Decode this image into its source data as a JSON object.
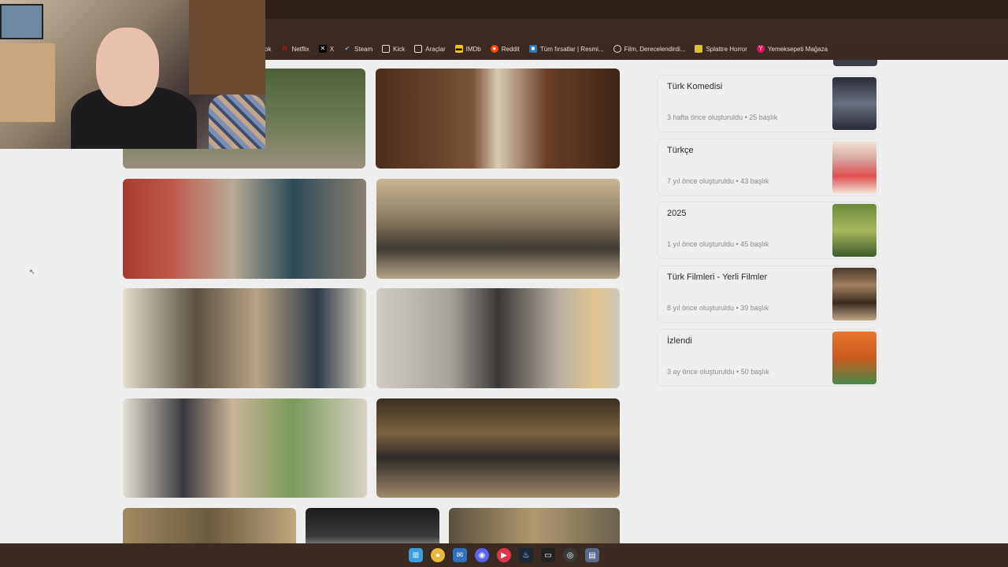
{
  "bookmarks": [
    {
      "label": "ok",
      "icon": "bookmark-icon"
    },
    {
      "label": "Netflix",
      "icon": "netflix-icon",
      "color": "#e50914"
    },
    {
      "label": "X",
      "icon": "x-icon",
      "color": "#000000"
    },
    {
      "label": "Steam",
      "icon": "steam-icon",
      "color": "#1b6fb7"
    },
    {
      "label": "Kick",
      "icon": "folder-icon"
    },
    {
      "label": "Araçlar",
      "icon": "folder-icon"
    },
    {
      "label": "IMDb",
      "icon": "imdb-icon",
      "color": "#f5c518"
    },
    {
      "label": "Reddit",
      "icon": "reddit-icon",
      "color": "#ff4500"
    },
    {
      "label": "Tüm fırsatlar | Resmi...",
      "icon": "store-icon",
      "color": "#2a7ab8"
    },
    {
      "label": "Film, Derecelendirdi...",
      "icon": "globe-icon"
    },
    {
      "label": "Splattre Horror",
      "icon": "splatter-icon",
      "color": "#d7c03a"
    },
    {
      "label": "Yemeksepeti Mağaza",
      "icon": "yemeksepeti-icon",
      "color": "#e0115f"
    }
  ],
  "lists": [
    {
      "title": "Türk Komedisi",
      "meta": "3 hafta önce oluşturuldu • 25 başlık",
      "poster": "#4a4f5c"
    },
    {
      "title": "Türkçe",
      "meta": "7 yıl önce oluşturuldu • 43 başlık",
      "poster": "#d9a6a0"
    },
    {
      "title": "2025",
      "meta": "1 yıl önce oluşturuldu • 45 başlık",
      "poster": "#8aa04e"
    },
    {
      "title": "Türk Filmleri - Yerli Filmler",
      "meta": "8 yıl önce oluşturuldu • 39 başlık",
      "poster": "#7a6048"
    },
    {
      "title": "İzlendi",
      "meta": "3 ay önce oluşturuldu • 50 başlık",
      "poster": "#e8762e"
    }
  ],
  "taskbar": [
    {
      "icon": "windows-start-icon",
      "color": "#3b9de0"
    },
    {
      "icon": "chrome-icon",
      "color": "#e8b93a"
    },
    {
      "icon": "mail-icon",
      "color": "#2f72c4"
    },
    {
      "icon": "discord-icon",
      "color": "#5865f2"
    },
    {
      "icon": "media-player-icon",
      "color": "#e0344a"
    },
    {
      "icon": "steam-icon",
      "color": "#1b2838"
    },
    {
      "icon": "terminal-icon",
      "color": "#222222"
    },
    {
      "icon": "obs-icon",
      "color": "#3a3a3a"
    },
    {
      "icon": "notepad-icon",
      "color": "#5a6a8a"
    }
  ],
  "colors": {
    "chrome": "#3a2a22",
    "page": "#eeeeee"
  }
}
